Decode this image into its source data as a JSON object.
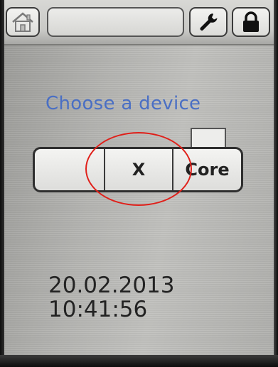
{
  "toolbar": {
    "home_icon": "home-icon",
    "title_value": "",
    "settings_icon": "wrench-icon",
    "lock_icon": "lock-icon"
  },
  "main": {
    "prompt": "Choose a device",
    "devices": [
      "",
      "X",
      "Core"
    ],
    "selected_device": "X"
  },
  "status": {
    "date": "20.02.2013",
    "time": "10:41:56"
  },
  "colors": {
    "prompt_text": "#4a6fc4",
    "annotation": "#e0201a"
  }
}
